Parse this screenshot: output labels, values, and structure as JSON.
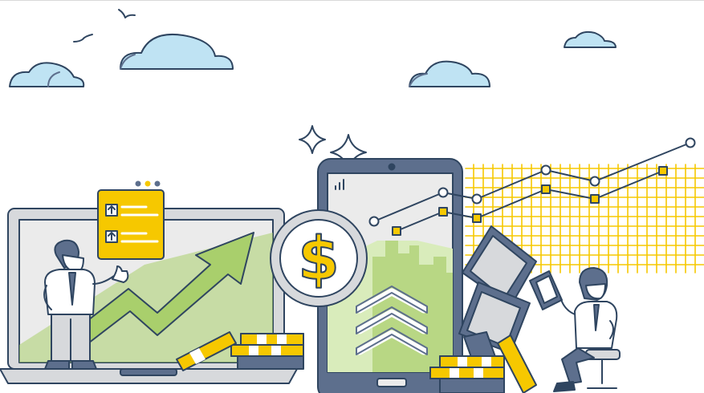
{
  "illustration": {
    "theme": "financial-growth",
    "colors": {
      "outline": "#2f4560",
      "sky_blue": "#bfe3f3",
      "slate": "#5d6f8d",
      "gold": "#f6c800",
      "gold_light": "#fde9a6",
      "green": "#a9cf6c",
      "green_light": "#d9ecbb",
      "screen_grey": "#ebebeb",
      "device_grey": "#d7d9dc"
    },
    "icons": [
      "cloud-icon",
      "bird-icon",
      "sparkle-icon",
      "dollar-icon",
      "arrow-up-icon",
      "signal-bars-icon",
      "up-chevrons-icon"
    ]
  }
}
